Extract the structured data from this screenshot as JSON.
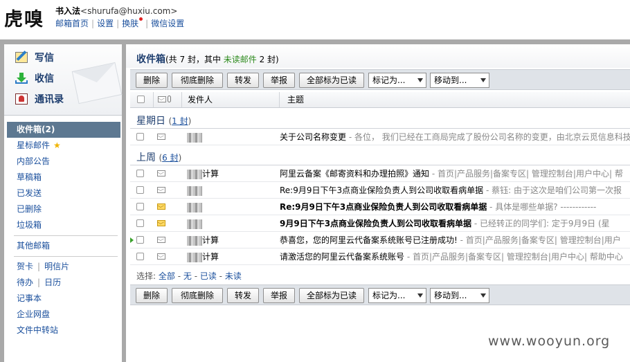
{
  "header": {
    "logo": "虎嗅",
    "nickname": "书入法",
    "email": "<shurufa@huxiu.com>",
    "links": [
      "邮箱首页",
      "设置",
      "换肤",
      "微信设置"
    ]
  },
  "sidebar": {
    "compose": "写信",
    "receive": "收信",
    "contacts": "通讯录",
    "folders": [
      {
        "label": "收件箱(2)",
        "active": true
      },
      {
        "label": "星标邮件"
      },
      {
        "label": "内部公告"
      },
      {
        "label": "草稿箱"
      },
      {
        "label": "已发送"
      },
      {
        "label": "已删除"
      },
      {
        "label": "垃圾箱"
      }
    ],
    "other_mail": "其他邮箱",
    "tools": {
      "card": "贺卡",
      "postcard": "明信片",
      "todo": "待办",
      "calendar": "日历",
      "notes": "记事本",
      "netdisk": "企业网盘",
      "transfer": "文件中转站"
    }
  },
  "main": {
    "title": {
      "name": "收件箱",
      "prefix": "(共 7 封，其中 ",
      "unread_label": "未读邮件",
      "suffix": " 2 封)"
    },
    "toolbar": {
      "delete": "删除",
      "purge": "彻底删除",
      "forward": "转发",
      "report": "举报",
      "mark_all_read": "全部标为已读",
      "mark_as": "标记为...",
      "move_to": "移动到..."
    },
    "columns": {
      "from": "发件人",
      "subject": "主题"
    },
    "groups": [
      {
        "name": "星期日",
        "count": "1 封"
      },
      {
        "name": "上周",
        "count": "6 封"
      }
    ],
    "rows": [
      {
        "from": "",
        "subject": "关于公司名称变更",
        "preview": " - 各位， 我们已经在工商局完成了股份公司名称的变更，由北京云觅信息科技",
        "unread": false
      },
      {
        "from": "计算",
        "subject": "阿里云备案《邮寄资料和办理拍照》通知",
        "preview": " - 首页|产品服务|备案专区| 管理控制台|用户中心| 帮",
        "unread": false
      },
      {
        "from": "",
        "subject": "Re:9月9日下午3点商业保险负责人到公司收取看病单据",
        "preview": " - 蔡钰: 由于这次是咱们公司第一次报",
        "unread": false
      },
      {
        "from": "",
        "subject": "Re:9月9日下午3点商业保险负责人到公司收取看病单据",
        "preview": " - 具体是哪些单据? ------------",
        "unread": true
      },
      {
        "from": "",
        "subject": "9月9日下午3点商业保险负责人到公司收取看病单据",
        "preview": " - 已经转正的同学们: 定于9月9日 (星",
        "unread": true
      },
      {
        "from": "计算",
        "subject": "恭喜您，您的阿里云代备案系统账号已注册成功!",
        "preview": " - 首页|产品服务|备案专区| 管理控制台|用户",
        "unread": false
      },
      {
        "from": "计算",
        "subject": "请激活您的阿里云代备案系统账号",
        "preview": " - 首页|产品服务|备案专区| 管理控制台|用户中心| 帮助中心",
        "unread": false
      }
    ],
    "select": {
      "label": "选择:",
      "all": "全部",
      "none": "无",
      "read": "已读",
      "unread": "未读"
    }
  },
  "watermark": "www.wooyun.org",
  "colors": {
    "active_folder": "#5d7891",
    "link": "#1a4f9c",
    "unread_green": "#2e8b1e",
    "frame": "#a9a9a9"
  }
}
